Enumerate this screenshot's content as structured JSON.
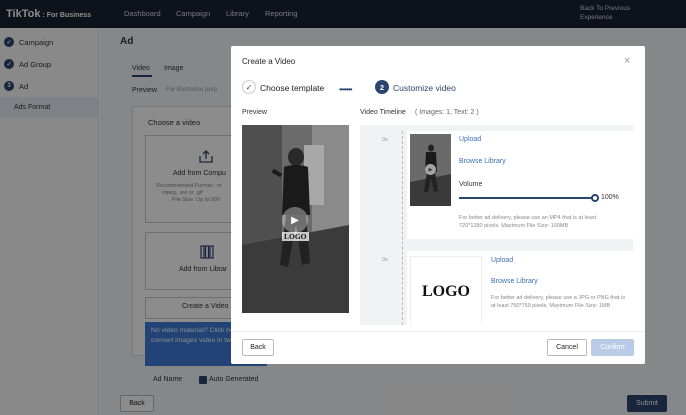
{
  "brand": {
    "name": "TikTok",
    "suffix": ": For Business"
  },
  "topnav": {
    "items": [
      "Dashboard",
      "Campaign",
      "Library",
      "Reporting"
    ],
    "back_to_previous": "Back To Previous Experience"
  },
  "sidebar": {
    "items": [
      {
        "label": "Campaign",
        "marker": "✓"
      },
      {
        "label": "Ad Group",
        "marker": "✓"
      },
      {
        "label": "Ad",
        "marker": "3"
      }
    ],
    "sub_item": "Ads Format"
  },
  "background": {
    "title": "Ad",
    "tabs": [
      "Video",
      "Image"
    ],
    "preview_label": "Preview",
    "preview_hint": "For illustrative purp",
    "choose_video": "Choose a video",
    "add_from_computer": "Add from Compu",
    "recommended": "Recommended Format: .m",
    "formats": "mpeg, .avi or .gif",
    "file_size": "File Size: Up to 500",
    "add_from_library": "Add from Librar",
    "create_video": "Create a Video",
    "tooltip": "No video material? Click here to convert images video in two steps.",
    "ad_name_label": "Ad Name",
    "auto_generated": "Auto Generated",
    "back": "Back",
    "submit": "Submit"
  },
  "modal": {
    "title": "Create a Video",
    "close_glyph": "×",
    "step1": {
      "marker": "✓",
      "label": "Choose template"
    },
    "step_dots": "•••••••",
    "step2": {
      "number": "2",
      "label": "Customize video"
    },
    "preview_label": "Preview",
    "preview_logo": "LOGO",
    "timeline_label": "Video Timeline",
    "timeline_counts": "( Images: 1, Text: 2 )",
    "timeline": {
      "video": {
        "time": "0s",
        "upload": "Upload",
        "browse": "Browse Library",
        "volume_label": "Volume",
        "volume_pct": 100,
        "volume_text": "100%",
        "hint": "For better ad delivery, please use an MP4 that is at least 720*1280 pixels. Maximum File Size: 100MB"
      },
      "image": {
        "time": "0s",
        "logo_text": "LOGO",
        "upload": "Upload",
        "browse": "Browse Library",
        "hint": "For better ad delivery, please use a JPG or PNG that is at least 750*750 pixels. Maximum File Size: 1MB"
      }
    },
    "buttons": {
      "back": "Back",
      "cancel": "Cancel",
      "confirm": "Confirm"
    }
  },
  "colors": {
    "navy": "#1b2132",
    "accent": "#2a4670",
    "link": "#3d6fb7",
    "tooltip": "#3d7bd7"
  }
}
